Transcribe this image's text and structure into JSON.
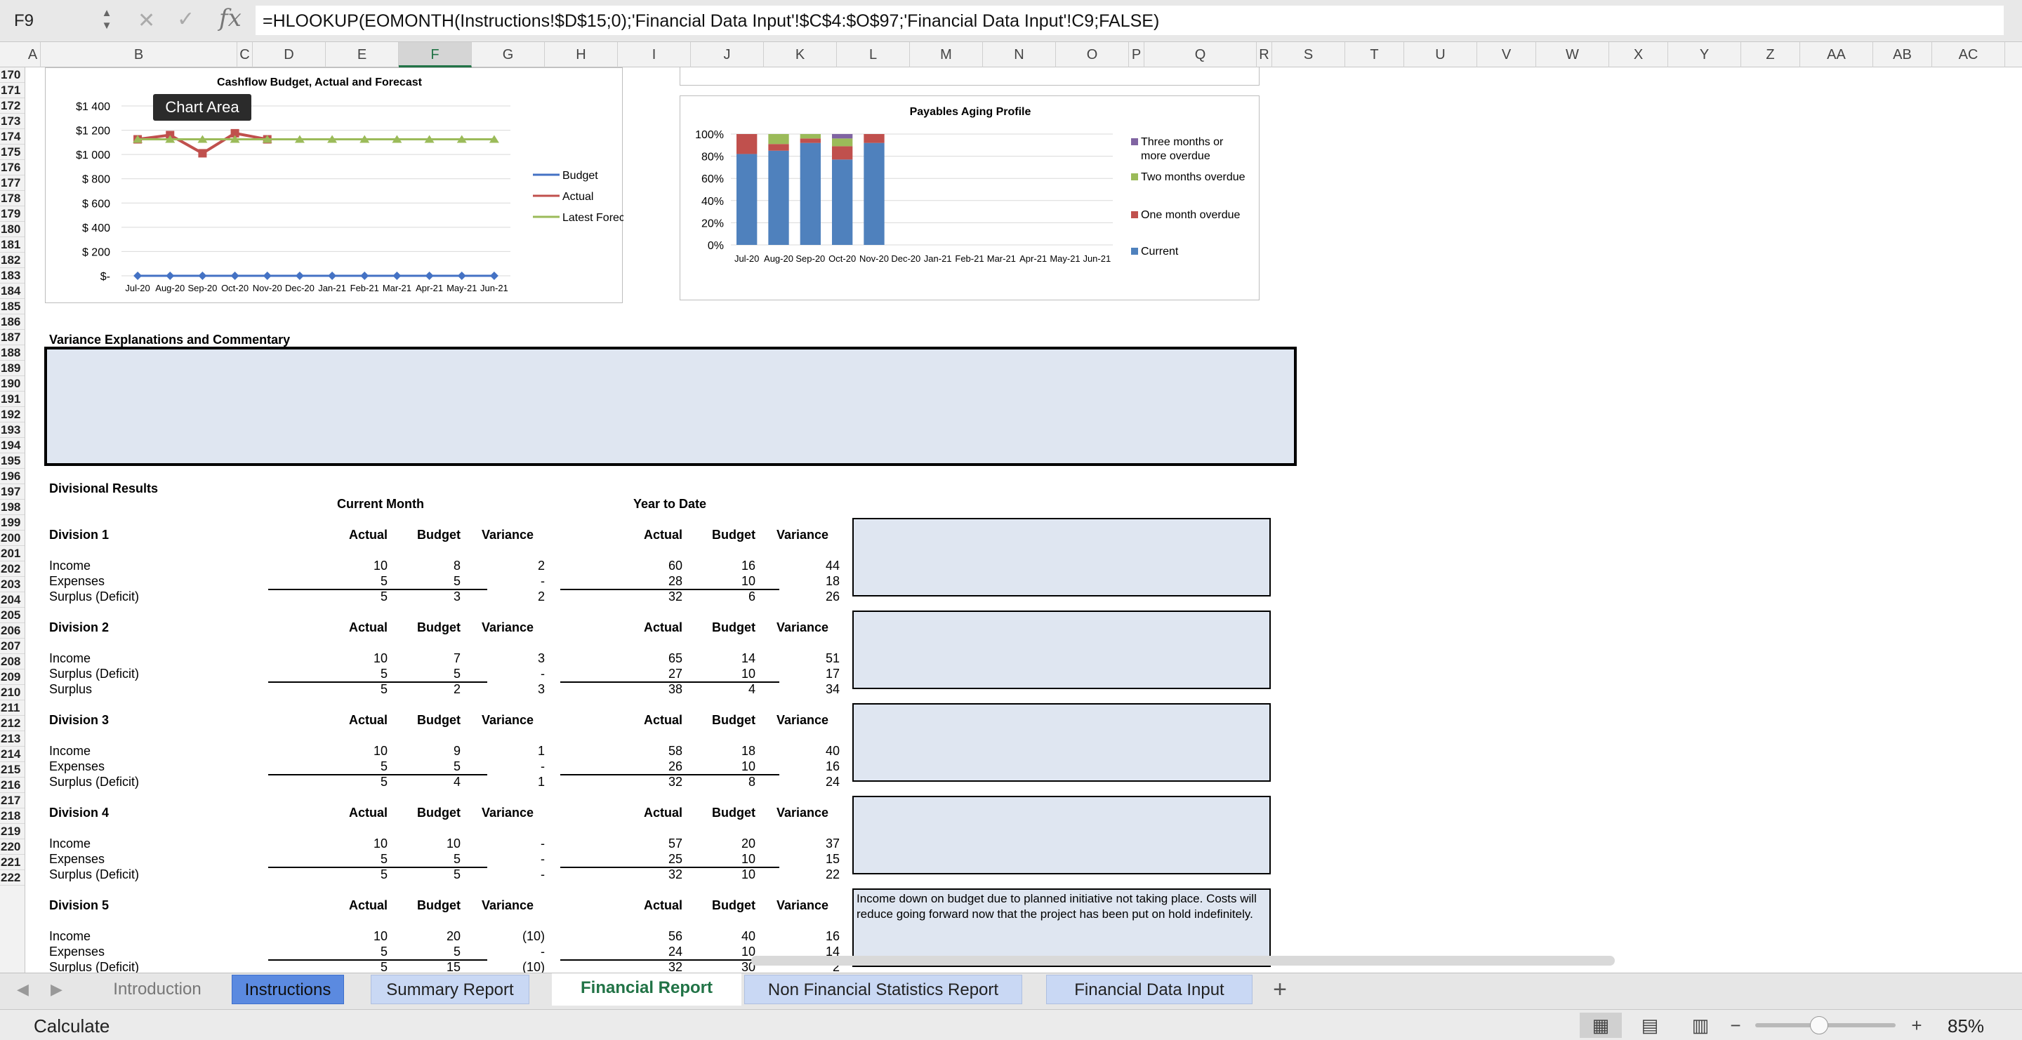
{
  "namebox": "F9",
  "formula": "=HLOOKUP(EOMONTH(Instructions!$D$15;0);'Financial Data Input'!$C$4:$O$97;'Financial Data Input'!C9;FALSE)",
  "columns": [
    "A",
    "B",
    "C",
    "D",
    "E",
    "F",
    "G",
    "H",
    "I",
    "J",
    "K",
    "L",
    "M",
    "N",
    "O",
    "P",
    "Q",
    "R",
    "S",
    "T",
    "U",
    "V",
    "W",
    "X",
    "Y",
    "Z",
    "AA",
    "AB",
    "AC"
  ],
  "rows": [
    "170",
    "171",
    "172",
    "173",
    "174",
    "175",
    "176",
    "177",
    "178",
    "179",
    "180",
    "181",
    "182",
    "183",
    "184",
    "185",
    "186",
    "187",
    "188",
    "189",
    "190",
    "191",
    "192",
    "193",
    "194",
    "195",
    "196",
    "197",
    "198",
    "199",
    "200",
    "201",
    "202",
    "203",
    "204",
    "205",
    "206",
    "207",
    "208",
    "209",
    "210",
    "211",
    "212",
    "213",
    "214",
    "215",
    "216",
    "217",
    "218",
    "219",
    "220",
    "221",
    "222"
  ],
  "tooltip": "Chart Area",
  "chart_data": [
    {
      "type": "line",
      "title": "Cashflow Budget, Actual and Forecast",
      "categories": [
        "Jul-20",
        "Aug-20",
        "Sep-20",
        "Oct-20",
        "Nov-20",
        "Dec-20",
        "Jan-21",
        "Feb-21",
        "Mar-21",
        "Apr-21",
        "May-21",
        "Jun-21"
      ],
      "ylim": [
        0,
        1400
      ],
      "yticks": [
        "$1 400",
        "$1 200",
        "$1 000",
        "$ 800",
        "$ 600",
        "$ 400",
        "$ 200",
        "$-"
      ],
      "series": [
        {
          "name": "Budget",
          "color": "#4472c4",
          "values": [
            0,
            0,
            0,
            0,
            0,
            0,
            0,
            0,
            0,
            0,
            0,
            0
          ]
        },
        {
          "name": "Actual",
          "color": "#c0504d",
          "values": [
            1125,
            1160,
            1010,
            1175,
            1125
          ]
        },
        {
          "name": "Latest Forecast",
          "color": "#9bbb59",
          "values": [
            1125,
            1125,
            1125,
            1125,
            1125,
            1125,
            1125,
            1125,
            1125,
            1125,
            1125,
            1125
          ]
        }
      ],
      "legend": "right"
    },
    {
      "type": "bar",
      "stacked": true,
      "title": "Payables Aging Profile",
      "categories": [
        "Jul-20",
        "Aug-20",
        "Sep-20",
        "Oct-20",
        "Nov-20",
        "Dec-20",
        "Jan-21",
        "Feb-21",
        "Mar-21",
        "Apr-21",
        "May-21",
        "Jun-21"
      ],
      "ylim": [
        0,
        100
      ],
      "yticks": [
        "100%",
        "80%",
        "60%",
        "40%",
        "20%",
        "0%"
      ],
      "series": [
        {
          "name": "Current",
          "color": "#4f81bd",
          "values": [
            82,
            85,
            92,
            77,
            92
          ]
        },
        {
          "name": "One month overdue",
          "color": "#c0504d",
          "values": [
            18,
            6,
            4,
            12,
            8
          ]
        },
        {
          "name": "Two months overdue",
          "color": "#9bbb59",
          "values": [
            0,
            9,
            4,
            7,
            0
          ]
        },
        {
          "name": "Three months or more overdue",
          "color": "#8064a2",
          "values": [
            0,
            0,
            0,
            4,
            0
          ]
        }
      ],
      "legend": "right"
    }
  ],
  "sections": {
    "variance_title": "Variance Explanations and Commentary",
    "divisional_title": "Divisional Results",
    "current_month": "Current Month",
    "ytd": "Year to Date",
    "actual": "Actual",
    "budget": "Budget",
    "variance": "Variance"
  },
  "divisions": [
    {
      "name": "Division 1",
      "rows": [
        {
          "label": "Income",
          "cm": [
            "10",
            "8",
            "2"
          ],
          "ytd": [
            "60",
            "16",
            "44"
          ]
        },
        {
          "label": "Expenses",
          "cm": [
            "5",
            "5",
            "-"
          ],
          "ytd": [
            "28",
            "10",
            "18"
          ]
        },
        {
          "label": "Surplus (Deficit)",
          "cm": [
            "5",
            "3",
            "2"
          ],
          "ytd": [
            "32",
            "6",
            "26"
          ]
        }
      ],
      "comment": ""
    },
    {
      "name": "Division 2",
      "rows": [
        {
          "label": "Income",
          "cm": [
            "10",
            "7",
            "3"
          ],
          "ytd": [
            "65",
            "14",
            "51"
          ]
        },
        {
          "label": "Surplus (Deficit)",
          "cm": [
            "5",
            "5",
            "-"
          ],
          "ytd": [
            "27",
            "10",
            "17"
          ]
        },
        {
          "label": "Surplus",
          "cm": [
            "5",
            "2",
            "3"
          ],
          "ytd": [
            "38",
            "4",
            "34"
          ]
        }
      ],
      "comment": ""
    },
    {
      "name": "Division 3",
      "rows": [
        {
          "label": "Income",
          "cm": [
            "10",
            "9",
            "1"
          ],
          "ytd": [
            "58",
            "18",
            "40"
          ]
        },
        {
          "label": "Expenses",
          "cm": [
            "5",
            "5",
            "-"
          ],
          "ytd": [
            "26",
            "10",
            "16"
          ]
        },
        {
          "label": "Surplus (Deficit)",
          "cm": [
            "5",
            "4",
            "1"
          ],
          "ytd": [
            "32",
            "8",
            "24"
          ]
        }
      ],
      "comment": ""
    },
    {
      "name": "Division 4",
      "rows": [
        {
          "label": "Income",
          "cm": [
            "10",
            "10",
            "-"
          ],
          "ytd": [
            "57",
            "20",
            "37"
          ]
        },
        {
          "label": "Expenses",
          "cm": [
            "5",
            "5",
            "-"
          ],
          "ytd": [
            "25",
            "10",
            "15"
          ]
        },
        {
          "label": "Surplus (Deficit)",
          "cm": [
            "5",
            "5",
            "-"
          ],
          "ytd": [
            "32",
            "10",
            "22"
          ]
        }
      ],
      "comment": ""
    },
    {
      "name": "Division 5",
      "rows": [
        {
          "label": "Income",
          "cm": [
            "10",
            "20",
            "(10)"
          ],
          "ytd": [
            "56",
            "40",
            "16"
          ]
        },
        {
          "label": "Expenses",
          "cm": [
            "5",
            "5",
            "-"
          ],
          "ytd": [
            "24",
            "10",
            "14"
          ]
        },
        {
          "label": "Surplus (Deficit)",
          "cm": [
            "5",
            "15",
            "(10)"
          ],
          "ytd": [
            "32",
            "30",
            "2"
          ]
        }
      ],
      "comment": "Income down on budget due to planned initiative not taking place. Costs will reduce going forward now that the project has been put on hold indefinitely."
    }
  ],
  "tabs": [
    {
      "label": "Introduction",
      "style": "plain"
    },
    {
      "label": "Instructions",
      "style": "blue"
    },
    {
      "label": "Summary Report",
      "style": "light"
    },
    {
      "label": "Financial Report",
      "style": "active"
    },
    {
      "label": "Non Financial Statistics Report",
      "style": "light"
    },
    {
      "label": "Financial Data Input",
      "style": "light"
    }
  ],
  "status": {
    "mode": "Calculate",
    "zoom": "85%"
  }
}
